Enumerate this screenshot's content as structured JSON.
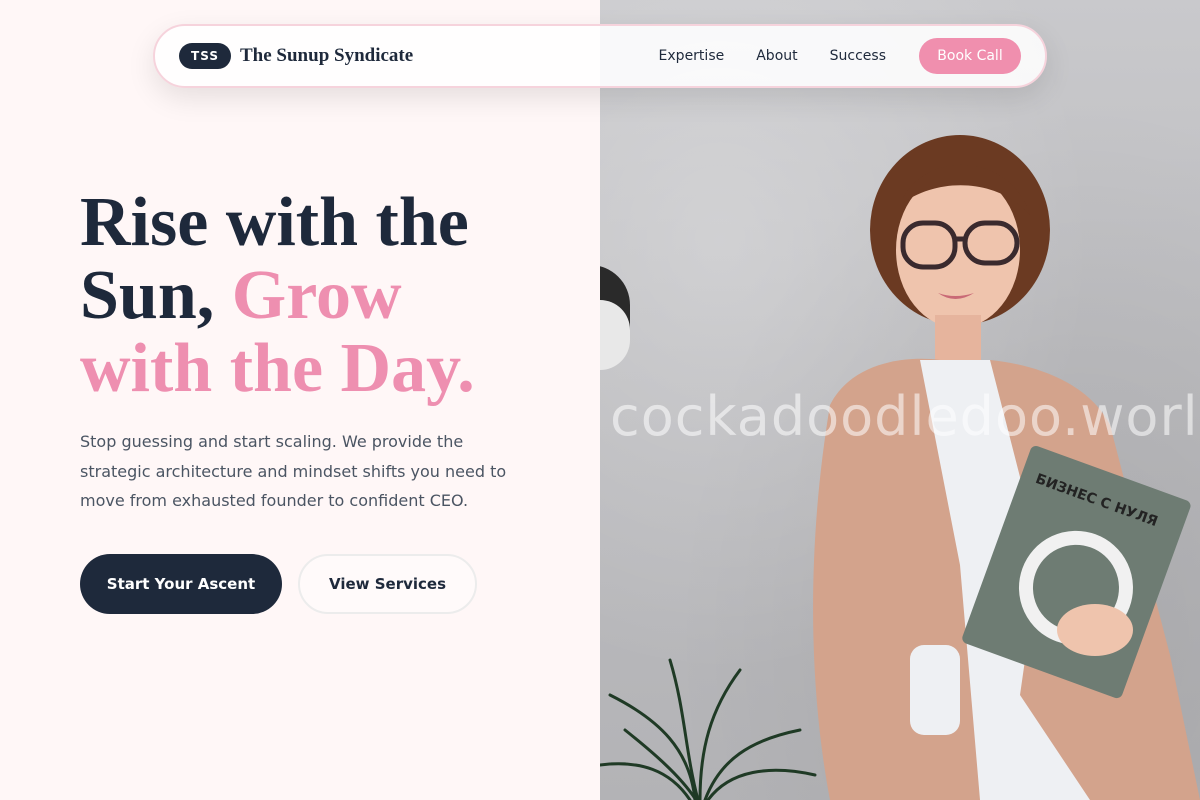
{
  "nav": {
    "logo_badge": "TSS",
    "brand": "The Sunup Syndicate",
    "links": [
      "Expertise",
      "About",
      "Success"
    ],
    "cta": "Book Call"
  },
  "hero": {
    "headline_line1": "Rise with the",
    "headline_line2_dark": "Sun,",
    "headline_line2_pink": "Grow",
    "headline_line3": "with the Day.",
    "description": "Stop guessing and start scaling. We provide the strategic architecture and mindset shifts you need to move from exhausted founder to confident CEO.",
    "primary_button": "Start Your Ascent",
    "secondary_button": "View Services"
  },
  "photo": {
    "watermark": "cockadoodledoo.world",
    "book_title": "БИЗНЕС С НУЛЯ"
  },
  "colors": {
    "navy": "#1e293b",
    "pink": "#f08fae",
    "background": "#fff7f7"
  }
}
